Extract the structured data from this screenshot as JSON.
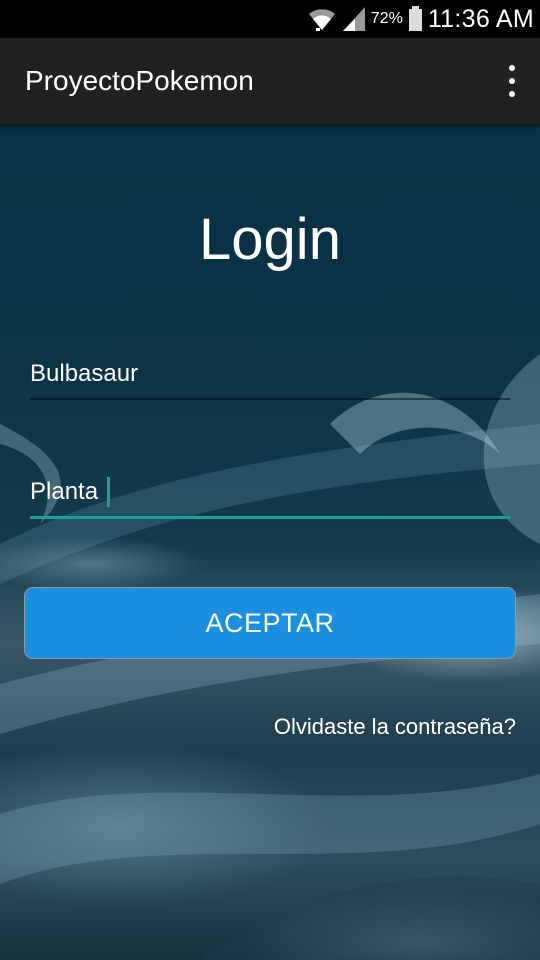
{
  "status_bar": {
    "battery_percent": "72%",
    "time": "11:36 AM",
    "icons": [
      "wifi-icon",
      "signal-icon",
      "battery-icon"
    ]
  },
  "app_bar": {
    "title": "ProyectoPokemon",
    "menu_icon": "overflow-menu-icon"
  },
  "login": {
    "title": "Login",
    "username_value": "Bulbasaur",
    "password_value": "Planta",
    "accept_label": "ACEPTAR",
    "forgot_label": "Olvidaste la contraseña?"
  },
  "colors": {
    "accent": "#1e9e95",
    "button": "#1a8fe0",
    "app_bar": "#212121",
    "status_bar": "#000000"
  }
}
